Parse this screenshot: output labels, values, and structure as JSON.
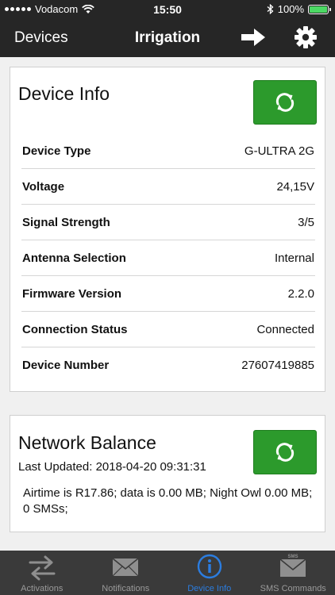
{
  "status_bar": {
    "carrier": "Vodacom",
    "time": "15:50",
    "battery": "100%"
  },
  "nav": {
    "back_label": "Devices",
    "title": "Irrigation"
  },
  "device_info": {
    "title": "Device Info",
    "rows": [
      {
        "label": "Device Type",
        "value": "G-ULTRA 2G"
      },
      {
        "label": "Voltage",
        "value": "24,15V"
      },
      {
        "label": "Signal Strength",
        "value": "3/5"
      },
      {
        "label": "Antenna Selection",
        "value": "Internal"
      },
      {
        "label": "Firmware Version",
        "value": "2.2.0"
      },
      {
        "label": "Connection Status",
        "value": "Connected"
      },
      {
        "label": "Device Number",
        "value": "27607419885"
      }
    ]
  },
  "network_balance": {
    "title": "Network Balance",
    "last_updated": "Last Updated: 2018-04-20 09:31:31",
    "text": "Airtime is R17.86; data is 0.00 MB; Night Owl 0.00 MB;  0 SMSs;"
  },
  "tabs": [
    {
      "label": "Activations",
      "icon": "swap-arrows-icon",
      "active": false
    },
    {
      "label": "Notifications",
      "icon": "envelope-icon",
      "active": false
    },
    {
      "label": "Device Info",
      "icon": "info-circle-icon",
      "active": true
    },
    {
      "label": "SMS Commands",
      "icon": "sms-envelope-icon",
      "active": false,
      "badge": "SMS"
    }
  ],
  "colors": {
    "bar_bg": "#262626",
    "refresh_green": "#2c9a2c",
    "tab_active": "#2b7de0",
    "tab_inactive": "#9a9a9a"
  }
}
